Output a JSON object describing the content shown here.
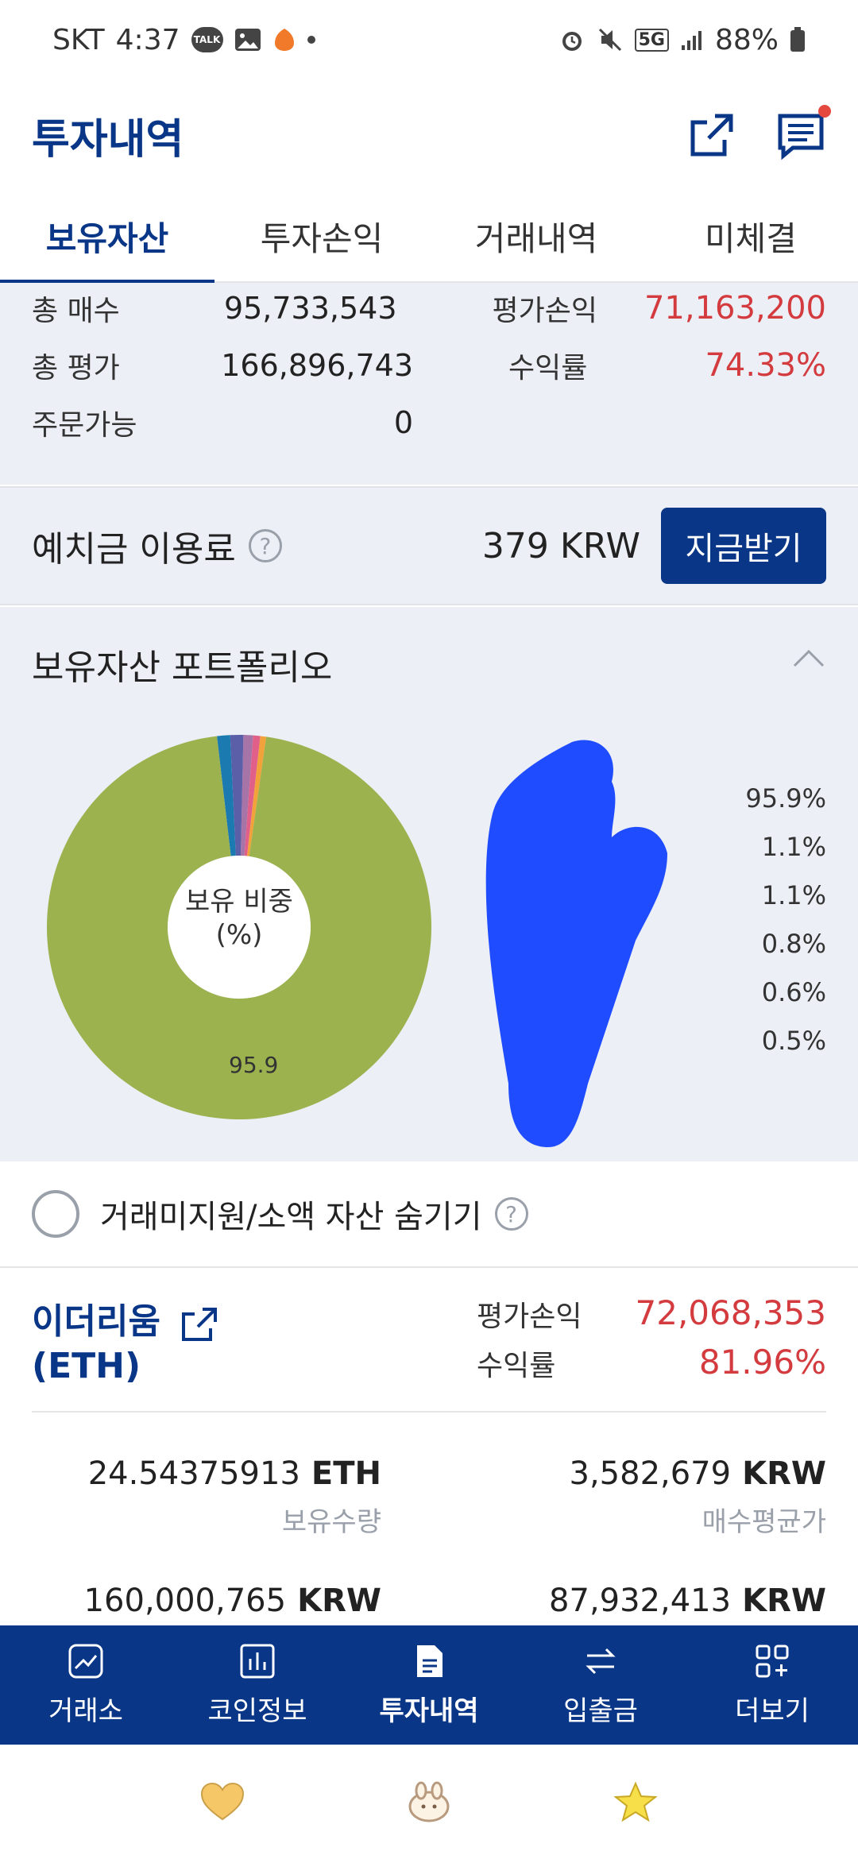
{
  "status_bar": {
    "carrier": "SKT",
    "time": "4:37",
    "talk_badge": "TALK",
    "network": "5G",
    "battery": "88%"
  },
  "header": {
    "title": "투자내역"
  },
  "tabs": [
    {
      "label": "보유자산",
      "active": true
    },
    {
      "label": "투자손익",
      "active": false
    },
    {
      "label": "거래내역",
      "active": false
    },
    {
      "label": "미체결",
      "active": false
    }
  ],
  "summary": {
    "total_buy_label": "총 매수",
    "total_buy_value": "95,733,543",
    "total_eval_label": "총 평가",
    "total_eval_value": "166,896,743",
    "orderable_label": "주문가능",
    "orderable_value": "0",
    "pnl_label": "평가손익",
    "pnl_value": "71,163,200",
    "return_label": "수익률",
    "return_value": "74.33%"
  },
  "deposit": {
    "label": "예치금 이용료",
    "help": "?",
    "amount": "379 KRW",
    "button": "지금받기"
  },
  "portfolio": {
    "title": "보유자산 포트폴리오",
    "center_label_1": "보유 비중",
    "center_label_2": "(%)",
    "donut_value_label": "95.9",
    "percentages": [
      "95.9%",
      "1.1%",
      "1.1%",
      "0.8%",
      "0.6%",
      "0.5%"
    ],
    "slice_values": [
      95.9,
      1.1,
      1.1,
      0.8,
      0.6,
      0.5
    ],
    "slice_colors": [
      "#9bb24f",
      "#1b7ab0",
      "#5a5fa8",
      "#a774a8",
      "#e0608a",
      "#f2a23a"
    ]
  },
  "hide_small": {
    "label": "거래미지원/소액 자산 숨기기",
    "help": "?"
  },
  "coin": {
    "name_line1": "이더리움",
    "name_line2": "(ETH)",
    "pnl_label": "평가손익",
    "pnl_value": "72,068,353",
    "return_label": "수익률",
    "return_value": "81.96%",
    "holding_qty": "24.54375913",
    "holding_unit": "ETH",
    "holding_label": "보유수량",
    "avg_price": "3,582,679",
    "avg_unit": "KRW",
    "avg_label": "매수평균가",
    "eval_amount": "160,000,765",
    "eval_unit": "KRW",
    "buy_amount": "87,932,413",
    "buy_unit": "KRW"
  },
  "bottom_nav": [
    {
      "label": "거래소",
      "icon": "chart-up-icon",
      "active": false
    },
    {
      "label": "코인정보",
      "icon": "bar-chart-icon",
      "active": false
    },
    {
      "label": "투자내역",
      "icon": "document-icon",
      "active": true
    },
    {
      "label": "입출금",
      "icon": "transfer-arrows-icon",
      "active": false
    },
    {
      "label": "더보기",
      "icon": "grid-plus-icon",
      "active": false
    }
  ],
  "colors": {
    "brand": "#093687",
    "negative_red": "#d33b3f",
    "panel_bg": "#eceff5",
    "redaction_blue": "#1f4cff"
  }
}
